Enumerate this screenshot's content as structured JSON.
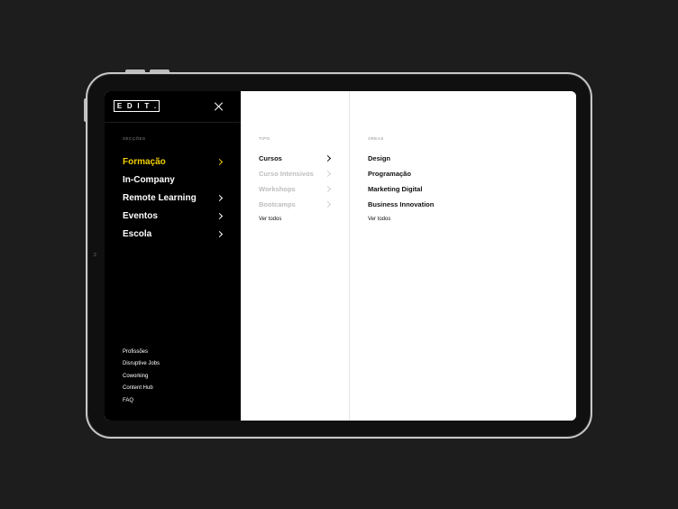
{
  "brand": {
    "logo_letters": [
      "E",
      "D",
      "I",
      "T",
      "."
    ]
  },
  "nav": {
    "section_label": "SECÇÕES",
    "items": [
      {
        "label": "Formação",
        "active": true,
        "has_chevron": true
      },
      {
        "label": "In-Company",
        "active": false,
        "has_chevron": false
      },
      {
        "label": "Remote Learning",
        "active": false,
        "has_chevron": true
      },
      {
        "label": "Eventos",
        "active": false,
        "has_chevron": true
      },
      {
        "label": "Escola",
        "active": false,
        "has_chevron": true
      }
    ],
    "footer": [
      "Profissões",
      "Disruptive Jobs",
      "Coworking",
      "Content Hub",
      "FAQ"
    ]
  },
  "tipo": {
    "label": "TIPO",
    "items": [
      {
        "label": "Cursos",
        "muted": false
      },
      {
        "label": "Curso Intensivos",
        "muted": true
      },
      {
        "label": "Workshops",
        "muted": true
      },
      {
        "label": "Bootcamps",
        "muted": true
      }
    ],
    "see_all": "Ver todos"
  },
  "areas": {
    "label": "ÁREAS",
    "items": [
      "Design",
      "Programação",
      "Marketing Digital",
      "Business Innovation"
    ],
    "see_all": "Ver todos"
  },
  "device": {
    "side_marker": "2"
  },
  "colors": {
    "background": "#1d1d1d",
    "active_accent": "#f2d000",
    "panel": "#000000"
  },
  "icons": {
    "close": "close-icon",
    "chevron": "chevron-right-icon"
  }
}
